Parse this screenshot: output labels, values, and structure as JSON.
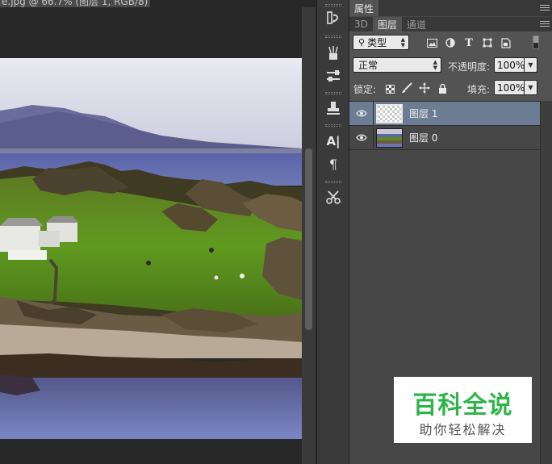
{
  "document": {
    "tab_title": "e.jpg @ 66.7% (图层 1, RGB/8)"
  },
  "tools": {
    "items": [
      {
        "name": "history-brush-icon"
      },
      {
        "name": "brush-presets-icon"
      },
      {
        "name": "adjustments-icon"
      },
      {
        "name": "clone-source-icon"
      },
      {
        "name": "character-icon",
        "glyph": "A|"
      },
      {
        "name": "paragraph-icon",
        "glyph": "¶"
      },
      {
        "name": "tool-presets-icon"
      }
    ]
  },
  "panels": {
    "top_tabs": [
      "属性"
    ],
    "layer_tabs": [
      "3D",
      "图层",
      "通道"
    ],
    "active_layer_tab": "图层"
  },
  "layers_panel": {
    "filter_kind": "类型",
    "filter_icons": [
      "image-filter-icon",
      "adjustment-filter-icon",
      "type-filter-icon",
      "shape-filter-icon",
      "smartobject-filter-icon"
    ],
    "blend_mode": "正常",
    "opacity_label": "不透明度:",
    "opacity_value": "100%",
    "lock_label": "锁定:",
    "fill_label": "填充:",
    "fill_value": "100%",
    "layers": [
      {
        "name": "图层 1",
        "selected": true,
        "visible": true,
        "thumbnail": "transparent"
      },
      {
        "name": "图层 0",
        "selected": false,
        "visible": true,
        "thumbnail": "landscape"
      }
    ]
  },
  "watermark": {
    "title": "百科全说",
    "subtitle": "助你轻松解决"
  },
  "colors": {
    "panel_bg": "#535353",
    "selected_layer": "#6c7d93",
    "watermark_green": "#2fb44a"
  }
}
